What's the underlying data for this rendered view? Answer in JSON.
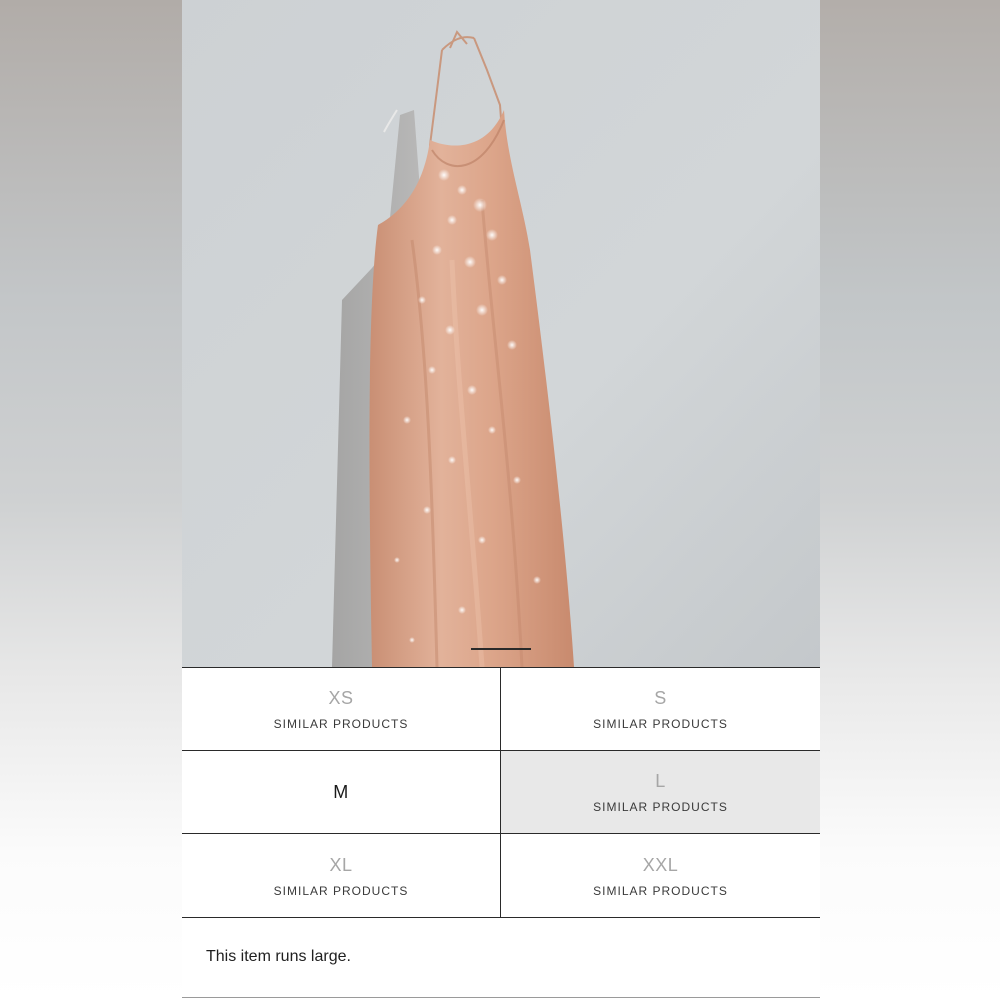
{
  "product": {
    "image_alt": "Sequin halter dress hanging on wall"
  },
  "sizes": [
    {
      "label": "XS",
      "sub": "SIMILAR PRODUCTS",
      "available": false,
      "selected": false
    },
    {
      "label": "S",
      "sub": "SIMILAR PRODUCTS",
      "available": false,
      "selected": false
    },
    {
      "label": "M",
      "sub": "",
      "available": true,
      "selected": false
    },
    {
      "label": "L",
      "sub": "SIMILAR PRODUCTS",
      "available": false,
      "selected": true
    },
    {
      "label": "XL",
      "sub": "SIMILAR PRODUCTS",
      "available": false,
      "selected": false
    },
    {
      "label": "XXL",
      "sub": "SIMILAR PRODUCTS",
      "available": false,
      "selected": false
    }
  ],
  "fit_note": "This item runs large.",
  "colors": {
    "border": "#2a2a2a",
    "selected_bg": "#e8e8e8",
    "unavailable_text": "#a6a6a6",
    "dress": "#d9a58a"
  }
}
